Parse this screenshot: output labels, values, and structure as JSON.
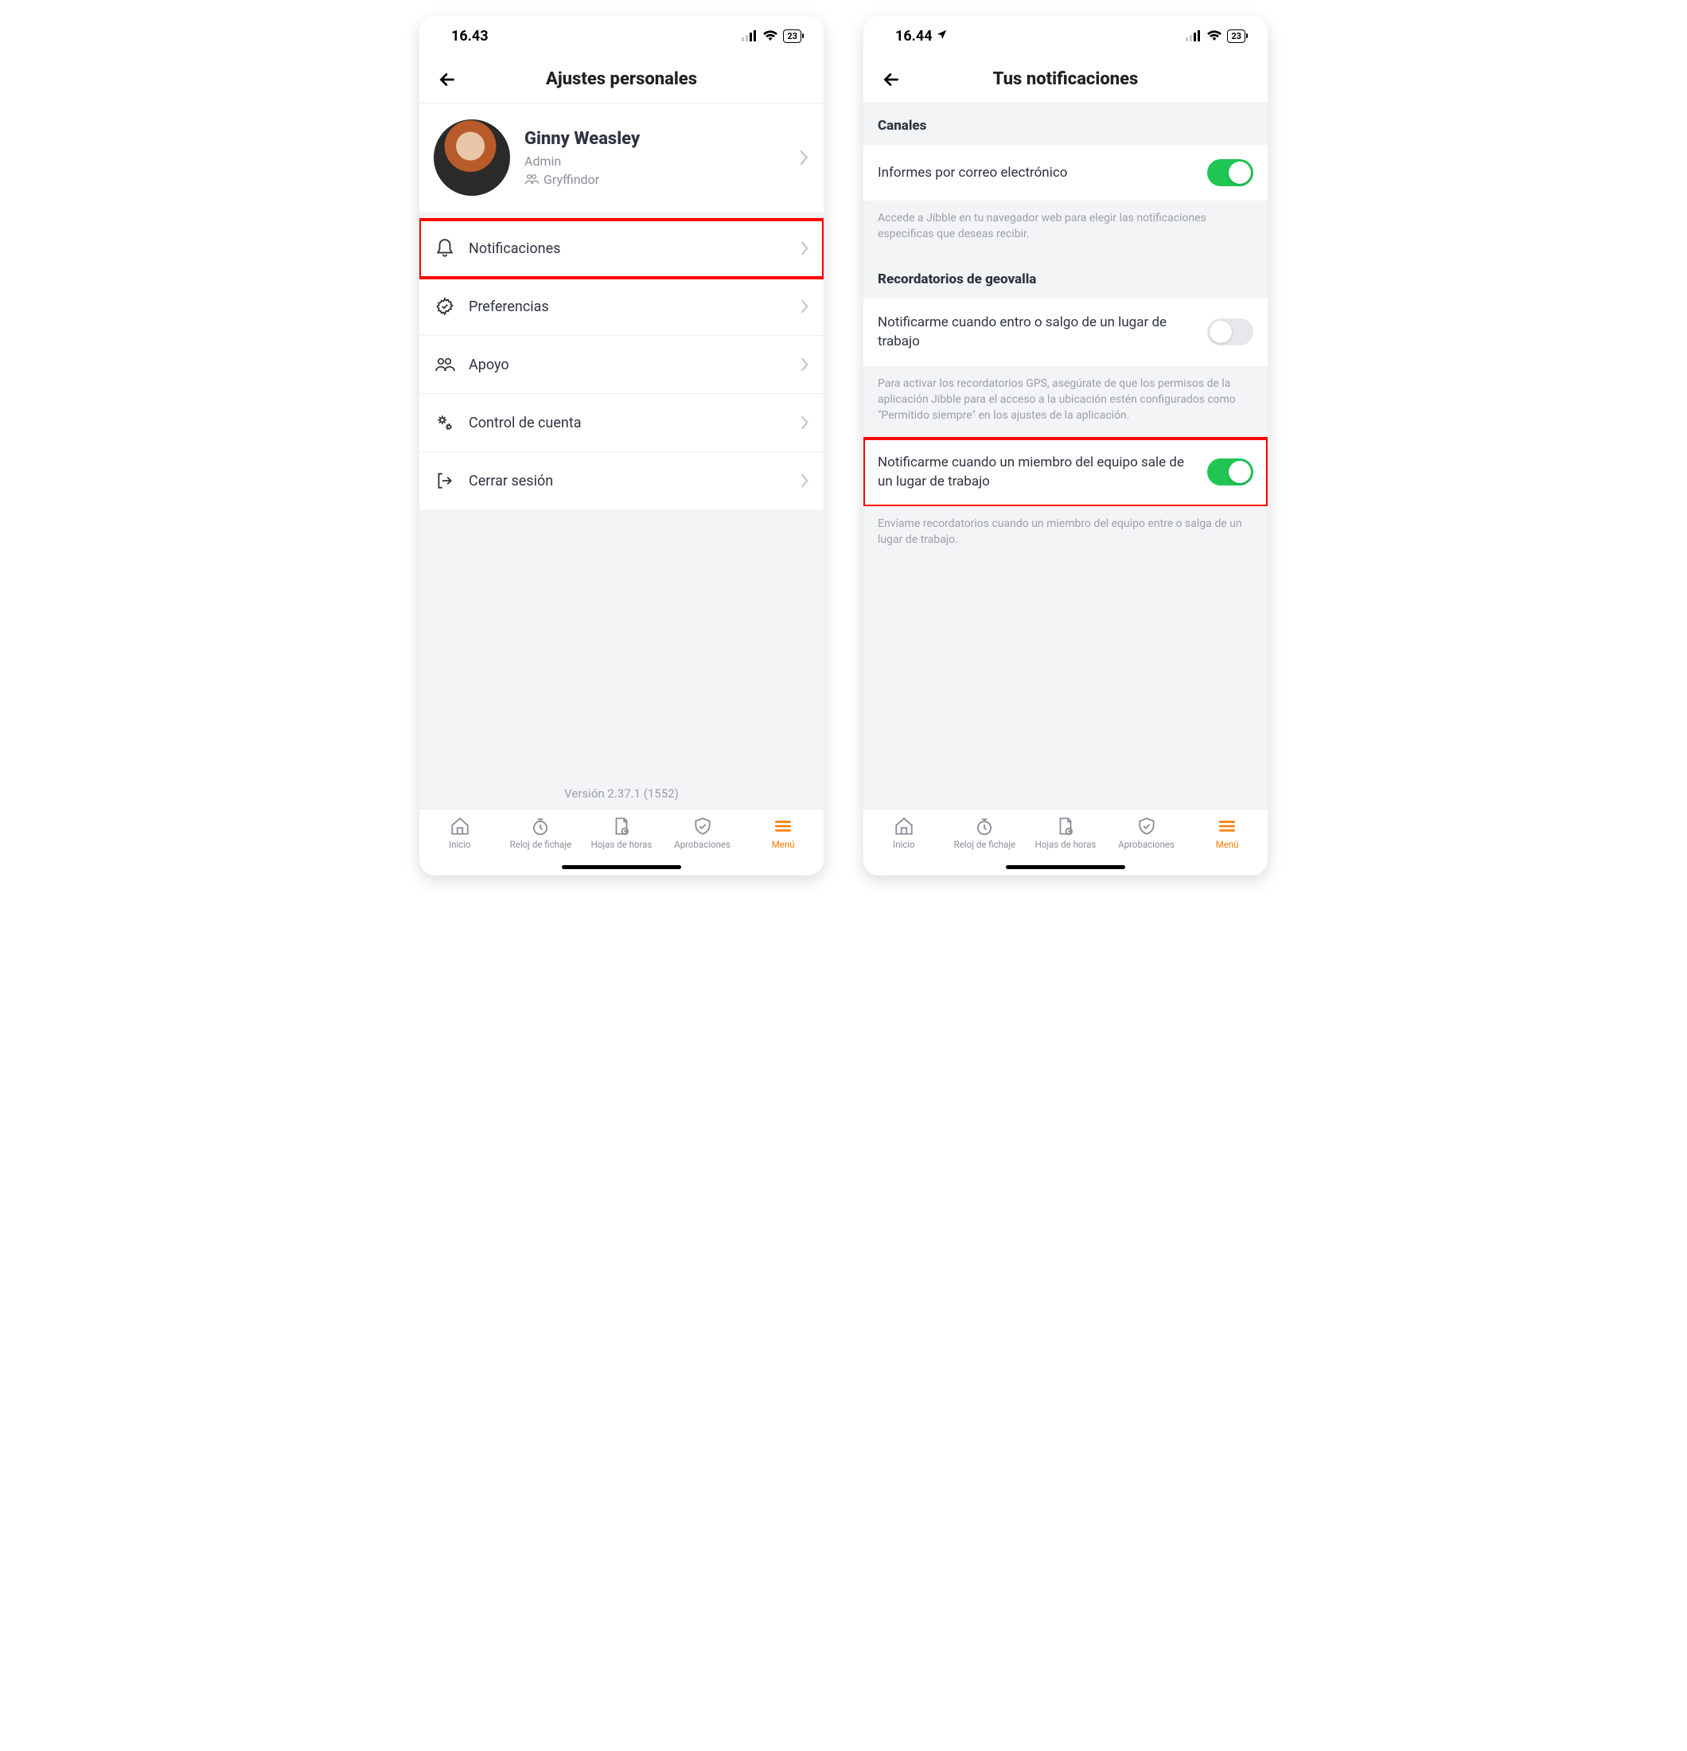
{
  "left": {
    "status": {
      "time": "16.43",
      "battery": "23"
    },
    "title": "Ajustes personales",
    "profile": {
      "name": "Ginny Weasley",
      "role": "Admin",
      "team": "Gryffindor"
    },
    "rows": {
      "notifications": "Notificaciones",
      "preferences": "Preferencias",
      "support": "Apoyo",
      "account": "Control de cuenta",
      "logout": "Cerrar sesión"
    },
    "version": "Versión 2.37.1 (1552)"
  },
  "right": {
    "status": {
      "time": "16.44",
      "battery": "23"
    },
    "title": "Tus notificaciones",
    "channels_header": "Canales",
    "email_reports": {
      "label": "Informes por correo electrónico",
      "on": true
    },
    "email_help": "Accede a Jibble en tu navegador web para elegir las notificaciones específicas que deseas recibir.",
    "geofence_header": "Recordatorios de geovalla",
    "notify_self": {
      "label": "Notificarme cuando entro o salgo de un lugar de trabajo",
      "on": false
    },
    "gps_help": "Para activar los recordatorios GPS, asegúrate de que los permisos de la aplicación Jibble para el acceso a la ubicación estén configurados como \"Permitido siempre\" en los ajustes de la aplicación.",
    "notify_team": {
      "label": "Notificarme cuando un miembro del equipo sale de un lugar de trabajo",
      "on": true
    },
    "team_help": "Envíame recordatorios cuando un miembro del equipo entre o salga de un lugar de trabajo."
  },
  "tabs": {
    "home": "Inicio",
    "timeclock": "Reloj de fichaje",
    "timesheets": "Hojas de horas",
    "approvals": "Aprobaciones",
    "menu": "Menú"
  }
}
